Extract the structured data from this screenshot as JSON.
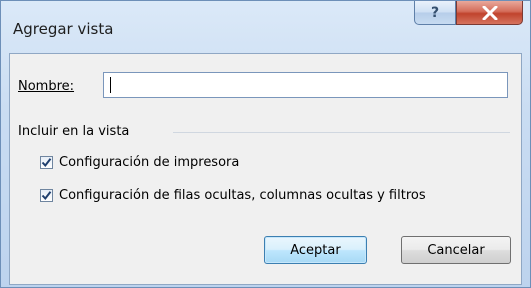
{
  "window": {
    "title": "Agregar vista",
    "help_glyph": "?"
  },
  "form": {
    "name_label": "Nombre:",
    "name_value": "",
    "group_label": "Incluir en la vista",
    "options": [
      {
        "label": "Configuración de impresora",
        "checked": true
      },
      {
        "label": "Configuración de filas ocultas, columnas ocultas y filtros",
        "checked": true
      }
    ]
  },
  "buttons": {
    "ok": "Aceptar",
    "cancel": "Cancelar"
  },
  "colors": {
    "close_button": "#c0432d",
    "accent_button_border": "#3c7fb1"
  }
}
